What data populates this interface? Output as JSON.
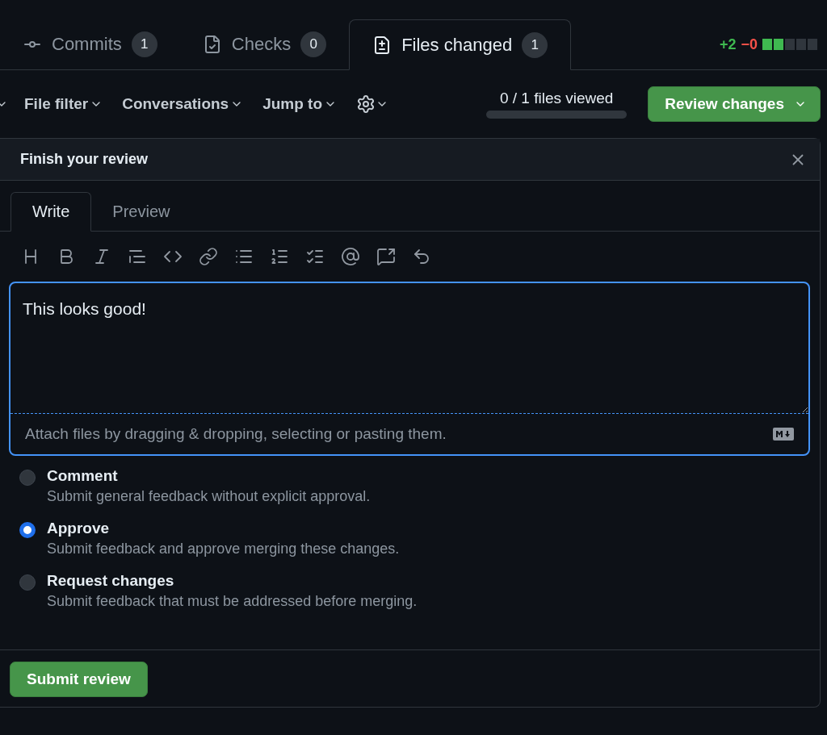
{
  "tabs": [
    {
      "label": "Commits",
      "count": "1",
      "selected": false
    },
    {
      "label": "Checks",
      "count": "0",
      "selected": false
    },
    {
      "label": "Files changed",
      "count": "1",
      "selected": true
    }
  ],
  "diffstat": {
    "added": "+2",
    "removed": "−0"
  },
  "filters": [
    "File filter",
    "Conversations",
    "Jump to"
  ],
  "files_viewed": {
    "text": "0 / 1 files viewed",
    "level": 0
  },
  "review_button": "Review changes",
  "panel": {
    "title": "Finish your review",
    "editor_tabs": [
      {
        "label": "Write",
        "selected": true
      },
      {
        "label": "Preview",
        "selected": false
      }
    ],
    "comment": "This looks good!",
    "attach_hint": "Attach files by dragging & dropping, selecting or pasting them.",
    "options": [
      {
        "label": "Comment",
        "description": "Submit general feedback without explicit approval.",
        "selected": false
      },
      {
        "label": "Approve",
        "description": "Submit feedback and approve merging these changes.",
        "selected": true
      },
      {
        "label": "Request changes",
        "description": "Submit feedback that must be addressed before merging.",
        "selected": false
      }
    ],
    "submit": "Submit review"
  }
}
